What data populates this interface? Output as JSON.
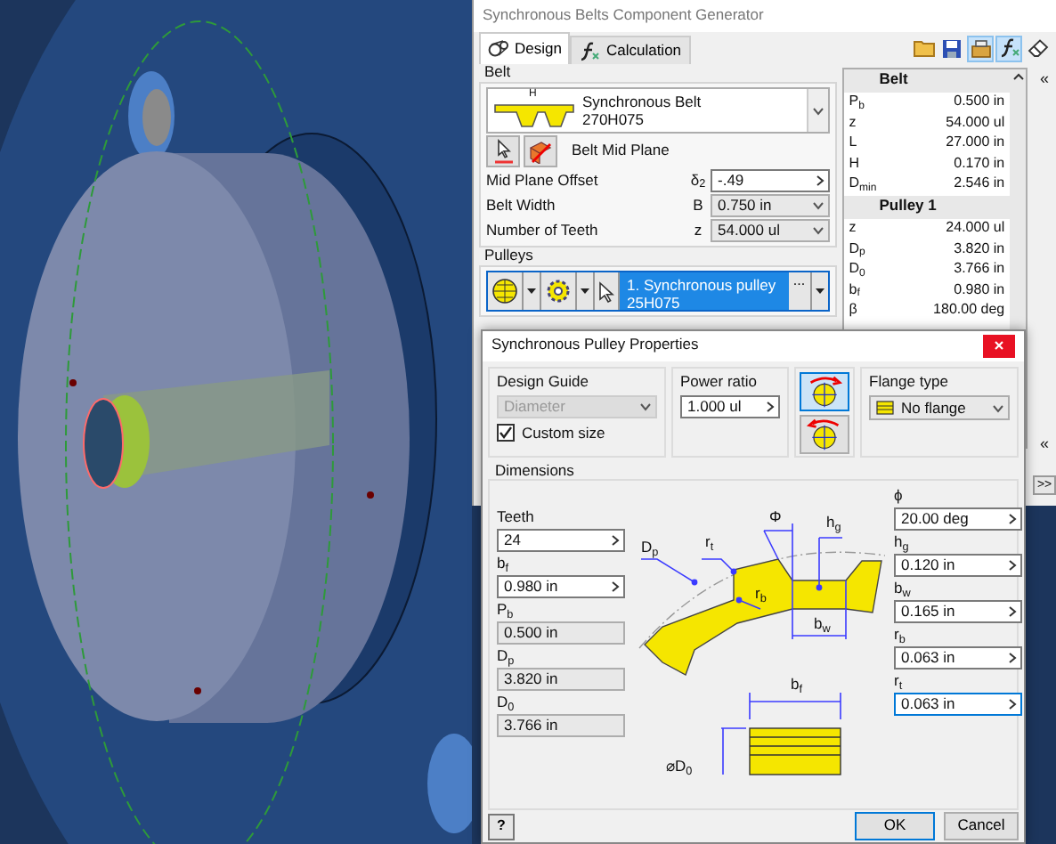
{
  "window": {
    "title": "Synchronous Belts Component Generator",
    "tabs": [
      {
        "label": "Design",
        "selected": true,
        "kind": "design"
      },
      {
        "label": "Calculation",
        "selected": false,
        "kind": "function"
      }
    ],
    "toolbar": [
      {
        "kind": "folder",
        "selected": false
      },
      {
        "kind": "save",
        "selected": false
      },
      {
        "kind": "tool",
        "selected": true
      },
      {
        "kind": "function",
        "selected": true
      },
      {
        "kind": "eraser",
        "selected": false
      }
    ],
    "belt": {
      "group": "Belt",
      "image_label": "H",
      "name": "Synchronous Belt",
      "code": "270H075",
      "mid_plane_label": "Belt Mid Plane",
      "params": [
        {
          "label": "Mid Plane Offset",
          "symbol": "δ$_{2}$",
          "value": "-.49",
          "kind": "input"
        },
        {
          "label": "Belt Width",
          "symbol": "B",
          "value": "0.750 in",
          "kind": "select"
        },
        {
          "label": "Number of Teeth",
          "symbol": "z",
          "value": "54.000 ul",
          "kind": "select"
        }
      ]
    },
    "pulleys": {
      "group": "Pulleys",
      "items": [
        {
          "label": "1. Synchronous pulley",
          "code": "25H075",
          "selected": true
        }
      ],
      "more_label": "..."
    },
    "results": [
      {
        "title": "Belt",
        "rows": [
          {
            "symbol": "P$_{b}$",
            "value": "0.500 in"
          },
          {
            "symbol": "z",
            "value": "54.000 ul"
          },
          {
            "symbol": "L",
            "value": "27.000 in"
          },
          {
            "symbol": "H",
            "value": "0.170 in"
          },
          {
            "symbol": "D$_{min}$",
            "value": "2.546 in"
          }
        ]
      },
      {
        "title": "Pulley 1",
        "rows": [
          {
            "symbol": "z",
            "value": "24.000 ul"
          },
          {
            "symbol": "D$_{p}$",
            "value": "3.820 in"
          },
          {
            "symbol": "D$_{0}$",
            "value": "3.766 in"
          },
          {
            "symbol": "b$_{f}$",
            "value": "0.980 in"
          },
          {
            "symbol": "β",
            "value": "180.00 deg"
          }
        ]
      }
    ],
    "strip": [
      "«",
      "«",
      ">>"
    ]
  },
  "dialog": {
    "title": "Synchronous Pulley Properties",
    "design_guide": {
      "label": "Design Guide",
      "value": "Diameter",
      "disabled": true
    },
    "custom_size": {
      "label": "Custom size",
      "checked": true
    },
    "power_ratio": {
      "label": "Power ratio",
      "value": "1.000 ul"
    },
    "rotation": [
      {
        "kind": "clockwise",
        "selected": true
      },
      {
        "kind": "counterclockwise",
        "selected": false
      }
    ],
    "flange": {
      "label": "Flange type",
      "value": "No flange"
    },
    "dimensions": {
      "label": "Dimensions",
      "left_fields": [
        {
          "label": "Teeth",
          "value": "24",
          "editable": true
        },
        {
          "label": "b$_{f}$",
          "value": "0.980 in",
          "editable": true
        },
        {
          "label": "P$_{b}$",
          "value": "0.500 in",
          "editable": false
        },
        {
          "label": "D$_{p}$",
          "value": "3.820 in",
          "editable": false
        },
        {
          "label": "D$_{0}$",
          "value": "3.766 in",
          "editable": false
        }
      ],
      "right_fields": [
        {
          "label": "ϕ",
          "value": "20.00 deg",
          "focused": false
        },
        {
          "label": "h$_{g}$",
          "value": "0.120 in",
          "focused": false
        },
        {
          "label": "b$_{w}$",
          "value": "0.165 in",
          "focused": false
        },
        {
          "label": "r$_{b}$",
          "value": "0.063 in",
          "focused": false
        },
        {
          "label": "r$_{t}$",
          "value": "0.063 in",
          "focused": true
        }
      ],
      "diagram_labels": [
        "D$_{p}$",
        "r$_{t}$",
        "Φ",
        "h$_{g}$",
        "r$_{b}$",
        "b$_{w}$",
        "b$_{f}$",
        "⌀D$_{0}$"
      ]
    },
    "help_label": "?",
    "buttons": [
      "OK",
      "Cancel"
    ]
  }
}
